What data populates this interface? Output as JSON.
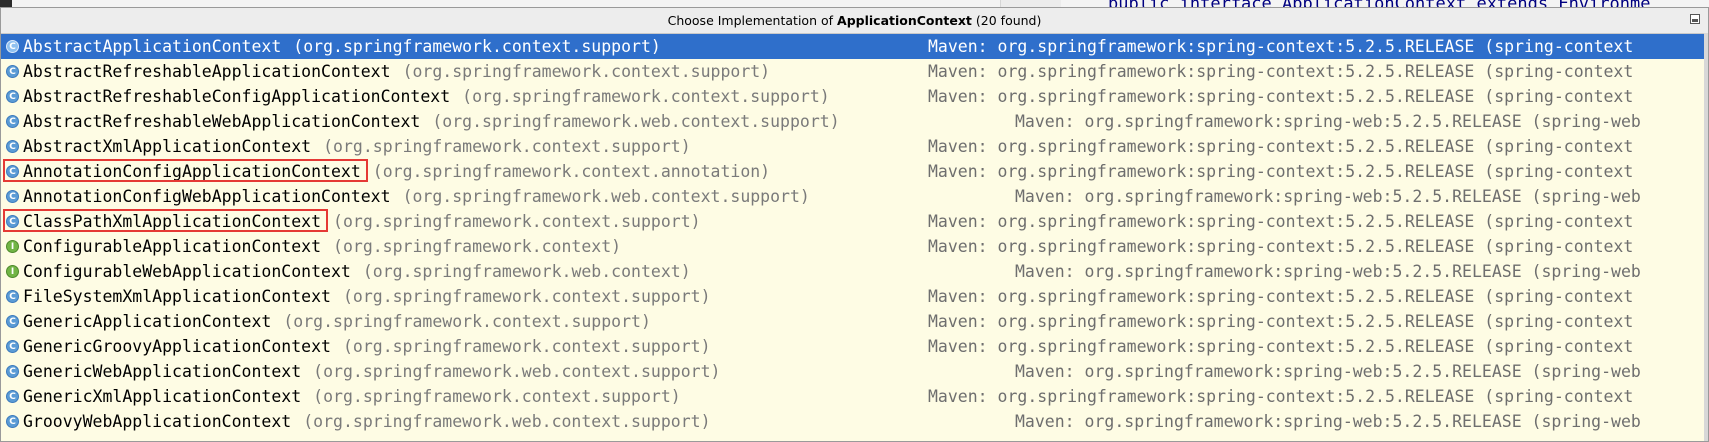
{
  "background_editor": {
    "code_snippet": "public interface ApplicationContext extends Environme"
  },
  "popup": {
    "title_prefix": "Choose Implementation of",
    "title_bold": "ApplicationContext",
    "title_suffix": "(20 found)"
  },
  "rows": [
    {
      "icon": "class-icon",
      "name": "AbstractApplicationContext",
      "pkg": "(org.springframework.context.support)",
      "maven": "Maven: org.springframework:spring-context:5.2.5.RELEASE (spring-context",
      "selected": true
    },
    {
      "icon": "class-icon",
      "name": "AbstractRefreshableApplicationContext",
      "pkg": "(org.springframework.context.support)",
      "maven": "Maven: org.springframework:spring-context:5.2.5.RELEASE (spring-context"
    },
    {
      "icon": "class-icon",
      "name": "AbstractRefreshableConfigApplicationContext",
      "pkg": "(org.springframework.context.support)",
      "maven": "Maven: org.springframework:spring-context:5.2.5.RELEASE (spring-context"
    },
    {
      "icon": "class-icon",
      "name": "AbstractRefreshableWebApplicationContext",
      "pkg": "(org.springframework.web.context.support)",
      "maven": "Maven: org.springframework:spring-web:5.2.5.RELEASE (spring-web"
    },
    {
      "icon": "class-icon",
      "name": "AbstractXmlApplicationContext",
      "pkg": "(org.springframework.context.support)",
      "maven": "Maven: org.springframework:spring-context:5.2.5.RELEASE (spring-context"
    },
    {
      "icon": "class-icon",
      "name": "AnnotationConfigApplicationContext",
      "pkg": "(org.springframework.context.annotation)",
      "maven": "Maven: org.springframework:spring-context:5.2.5.RELEASE (spring-context",
      "highlighted": true
    },
    {
      "icon": "class-icon",
      "name": "AnnotationConfigWebApplicationContext",
      "pkg": "(org.springframework.web.context.support)",
      "maven": "Maven: org.springframework:spring-web:5.2.5.RELEASE (spring-web"
    },
    {
      "icon": "class-icon",
      "name": "ClassPathXmlApplicationContext",
      "pkg": "(org.springframework.context.support)",
      "maven": "Maven: org.springframework:spring-context:5.2.5.RELEASE (spring-context",
      "highlighted": true
    },
    {
      "icon": "interface-icon",
      "name": "ConfigurableApplicationContext",
      "pkg": "(org.springframework.context)",
      "maven": "Maven: org.springframework:spring-context:5.2.5.RELEASE (spring-context"
    },
    {
      "icon": "interface-icon",
      "name": "ConfigurableWebApplicationContext",
      "pkg": "(org.springframework.web.context)",
      "maven": "Maven: org.springframework:spring-web:5.2.5.RELEASE (spring-web"
    },
    {
      "icon": "class-icon",
      "name": "FileSystemXmlApplicationContext",
      "pkg": "(org.springframework.context.support)",
      "maven": "Maven: org.springframework:spring-context:5.2.5.RELEASE (spring-context"
    },
    {
      "icon": "class-icon",
      "name": "GenericApplicationContext",
      "pkg": "(org.springframework.context.support)",
      "maven": "Maven: org.springframework:spring-context:5.2.5.RELEASE (spring-context"
    },
    {
      "icon": "class-icon",
      "name": "GenericGroovyApplicationContext",
      "pkg": "(org.springframework.context.support)",
      "maven": "Maven: org.springframework:spring-context:5.2.5.RELEASE (spring-context"
    },
    {
      "icon": "class-icon",
      "name": "GenericWebApplicationContext",
      "pkg": "(org.springframework.web.context.support)",
      "maven": "Maven: org.springframework:spring-web:5.2.5.RELEASE (spring-web"
    },
    {
      "icon": "class-icon",
      "name": "GenericXmlApplicationContext",
      "pkg": "(org.springframework.context.support)",
      "maven": "Maven: org.springframework:spring-context:5.2.5.RELEASE (spring-context"
    },
    {
      "icon": "class-icon",
      "name": "GroovyWebApplicationContext",
      "pkg": "(org.springframework.web.context.support)",
      "maven": "Maven: org.springframework:spring-web:5.2.5.RELEASE (spring-web"
    }
  ],
  "colors": {
    "selection": "#2f6fcb",
    "popup_background": "#fefce4",
    "highlight_border": "#e53935"
  }
}
